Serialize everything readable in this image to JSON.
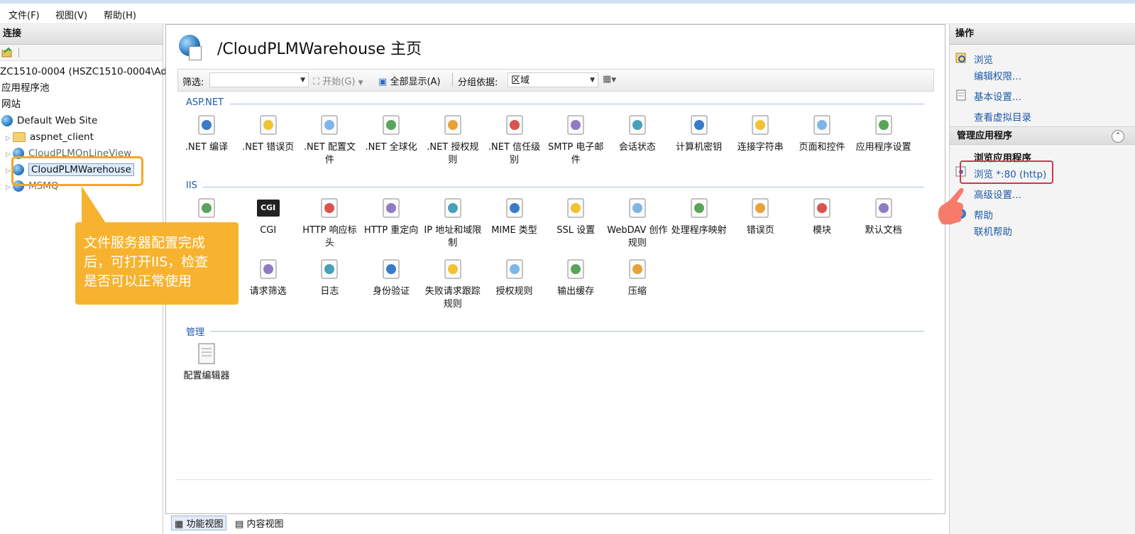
{
  "menu": [
    "文件(F)",
    "视图(V)",
    "帮助(H)"
  ],
  "connections": {
    "title": "连接",
    "server": "ZC1510-0004 (HSZC1510-0004\\Ad",
    "app_pools": "应用程序池",
    "sites": "网站",
    "default_site": "Default Web Site",
    "children": [
      "aspnet_client",
      "CloudPLMOnLineView",
      "CloudPLMWarehouse",
      "MSMQ"
    ]
  },
  "page": {
    "title": "/CloudPLMWarehouse 主页",
    "filter_label": "筛选:",
    "filter_value": "",
    "start_btn": "开始(G)",
    "show_all_btn": "全部显示(A)",
    "group_by_label": "分组依据:",
    "group_by_value": "区域"
  },
  "groups": {
    "aspnet": {
      "title": "ASP.NET",
      "items": [
        ".NET 编译",
        ".NET 错误页",
        ".NET 配置文件",
        ".NET 全球化",
        ".NET 授权规则",
        ".NET 信任级别",
        "SMTP 电子邮件",
        "会话状态",
        "计算机密钥",
        "连接字符串",
        "页面和控件",
        "应用程序设置"
      ]
    },
    "iis": {
      "title": "IIS",
      "row1": [
        "",
        "CGI",
        "HTTP 响应标头",
        "HTTP 重定向",
        "IP 地址和域限制",
        "MIME 类型",
        "SSL 设置",
        "WebDAV 创作规则",
        "处理程序映射",
        "错误页",
        "模块",
        "默认文档"
      ],
      "row2": [
        "",
        "请求筛选",
        "日志",
        "身份验证",
        "失败请求跟踪规则",
        "授权规则",
        "输出缓存",
        "压缩"
      ]
    },
    "manage": {
      "title": "管理",
      "items": [
        "配置编辑器"
      ]
    }
  },
  "bottom_tabs": [
    "功能视图",
    "内容视图"
  ],
  "actions": {
    "title": "操作",
    "browse": "浏览",
    "edit_perms": "编辑权限...",
    "basic_settings": "基本设置...",
    "view_vdirs": "查看虚拟目录",
    "manage_app": "管理应用程序",
    "browse_app": "浏览应用程序",
    "browse_http": "浏览 *:80 (http)",
    "advanced": "高级设置...",
    "help": "帮助",
    "online_help": "联机帮助"
  },
  "callout": {
    "line1": "文件服务器配置完成",
    "line2": "后，可打开IIS，检查",
    "line3": "是否可以正常使用"
  },
  "colors": {
    "link": "#1e5aa8",
    "callout": "#f7b32f",
    "highlight_red": "#d33551"
  }
}
